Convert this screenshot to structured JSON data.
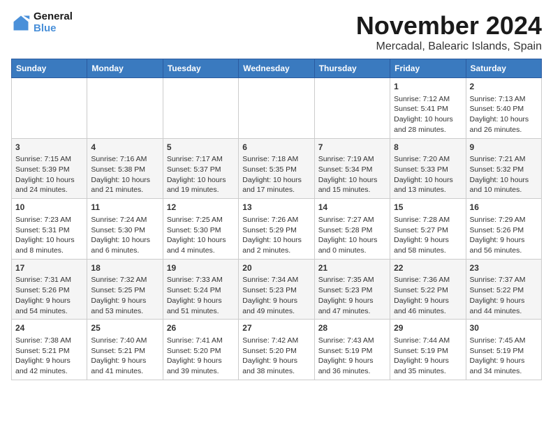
{
  "header": {
    "logo_line1": "General",
    "logo_line2": "Blue",
    "month_year": "November 2024",
    "location": "Mercadal, Balearic Islands, Spain"
  },
  "days_of_week": [
    "Sunday",
    "Monday",
    "Tuesday",
    "Wednesday",
    "Thursday",
    "Friday",
    "Saturday"
  ],
  "weeks": [
    [
      {
        "day": "",
        "sunrise": "",
        "sunset": "",
        "daylight": ""
      },
      {
        "day": "",
        "sunrise": "",
        "sunset": "",
        "daylight": ""
      },
      {
        "day": "",
        "sunrise": "",
        "sunset": "",
        "daylight": ""
      },
      {
        "day": "",
        "sunrise": "",
        "sunset": "",
        "daylight": ""
      },
      {
        "day": "",
        "sunrise": "",
        "sunset": "",
        "daylight": ""
      },
      {
        "day": "1",
        "sunrise": "Sunrise: 7:12 AM",
        "sunset": "Sunset: 5:41 PM",
        "daylight": "Daylight: 10 hours and 28 minutes."
      },
      {
        "day": "2",
        "sunrise": "Sunrise: 7:13 AM",
        "sunset": "Sunset: 5:40 PM",
        "daylight": "Daylight: 10 hours and 26 minutes."
      }
    ],
    [
      {
        "day": "3",
        "sunrise": "Sunrise: 7:15 AM",
        "sunset": "Sunset: 5:39 PM",
        "daylight": "Daylight: 10 hours and 24 minutes."
      },
      {
        "day": "4",
        "sunrise": "Sunrise: 7:16 AM",
        "sunset": "Sunset: 5:38 PM",
        "daylight": "Daylight: 10 hours and 21 minutes."
      },
      {
        "day": "5",
        "sunrise": "Sunrise: 7:17 AM",
        "sunset": "Sunset: 5:37 PM",
        "daylight": "Daylight: 10 hours and 19 minutes."
      },
      {
        "day": "6",
        "sunrise": "Sunrise: 7:18 AM",
        "sunset": "Sunset: 5:35 PM",
        "daylight": "Daylight: 10 hours and 17 minutes."
      },
      {
        "day": "7",
        "sunrise": "Sunrise: 7:19 AM",
        "sunset": "Sunset: 5:34 PM",
        "daylight": "Daylight: 10 hours and 15 minutes."
      },
      {
        "day": "8",
        "sunrise": "Sunrise: 7:20 AM",
        "sunset": "Sunset: 5:33 PM",
        "daylight": "Daylight: 10 hours and 13 minutes."
      },
      {
        "day": "9",
        "sunrise": "Sunrise: 7:21 AM",
        "sunset": "Sunset: 5:32 PM",
        "daylight": "Daylight: 10 hours and 10 minutes."
      }
    ],
    [
      {
        "day": "10",
        "sunrise": "Sunrise: 7:23 AM",
        "sunset": "Sunset: 5:31 PM",
        "daylight": "Daylight: 10 hours and 8 minutes."
      },
      {
        "day": "11",
        "sunrise": "Sunrise: 7:24 AM",
        "sunset": "Sunset: 5:30 PM",
        "daylight": "Daylight: 10 hours and 6 minutes."
      },
      {
        "day": "12",
        "sunrise": "Sunrise: 7:25 AM",
        "sunset": "Sunset: 5:30 PM",
        "daylight": "Daylight: 10 hours and 4 minutes."
      },
      {
        "day": "13",
        "sunrise": "Sunrise: 7:26 AM",
        "sunset": "Sunset: 5:29 PM",
        "daylight": "Daylight: 10 hours and 2 minutes."
      },
      {
        "day": "14",
        "sunrise": "Sunrise: 7:27 AM",
        "sunset": "Sunset: 5:28 PM",
        "daylight": "Daylight: 10 hours and 0 minutes."
      },
      {
        "day": "15",
        "sunrise": "Sunrise: 7:28 AM",
        "sunset": "Sunset: 5:27 PM",
        "daylight": "Daylight: 9 hours and 58 minutes."
      },
      {
        "day": "16",
        "sunrise": "Sunrise: 7:29 AM",
        "sunset": "Sunset: 5:26 PM",
        "daylight": "Daylight: 9 hours and 56 minutes."
      }
    ],
    [
      {
        "day": "17",
        "sunrise": "Sunrise: 7:31 AM",
        "sunset": "Sunset: 5:26 PM",
        "daylight": "Daylight: 9 hours and 54 minutes."
      },
      {
        "day": "18",
        "sunrise": "Sunrise: 7:32 AM",
        "sunset": "Sunset: 5:25 PM",
        "daylight": "Daylight: 9 hours and 53 minutes."
      },
      {
        "day": "19",
        "sunrise": "Sunrise: 7:33 AM",
        "sunset": "Sunset: 5:24 PM",
        "daylight": "Daylight: 9 hours and 51 minutes."
      },
      {
        "day": "20",
        "sunrise": "Sunrise: 7:34 AM",
        "sunset": "Sunset: 5:23 PM",
        "daylight": "Daylight: 9 hours and 49 minutes."
      },
      {
        "day": "21",
        "sunrise": "Sunrise: 7:35 AM",
        "sunset": "Sunset: 5:23 PM",
        "daylight": "Daylight: 9 hours and 47 minutes."
      },
      {
        "day": "22",
        "sunrise": "Sunrise: 7:36 AM",
        "sunset": "Sunset: 5:22 PM",
        "daylight": "Daylight: 9 hours and 46 minutes."
      },
      {
        "day": "23",
        "sunrise": "Sunrise: 7:37 AM",
        "sunset": "Sunset: 5:22 PM",
        "daylight": "Daylight: 9 hours and 44 minutes."
      }
    ],
    [
      {
        "day": "24",
        "sunrise": "Sunrise: 7:38 AM",
        "sunset": "Sunset: 5:21 PM",
        "daylight": "Daylight: 9 hours and 42 minutes."
      },
      {
        "day": "25",
        "sunrise": "Sunrise: 7:40 AM",
        "sunset": "Sunset: 5:21 PM",
        "daylight": "Daylight: 9 hours and 41 minutes."
      },
      {
        "day": "26",
        "sunrise": "Sunrise: 7:41 AM",
        "sunset": "Sunset: 5:20 PM",
        "daylight": "Daylight: 9 hours and 39 minutes."
      },
      {
        "day": "27",
        "sunrise": "Sunrise: 7:42 AM",
        "sunset": "Sunset: 5:20 PM",
        "daylight": "Daylight: 9 hours and 38 minutes."
      },
      {
        "day": "28",
        "sunrise": "Sunrise: 7:43 AM",
        "sunset": "Sunset: 5:19 PM",
        "daylight": "Daylight: 9 hours and 36 minutes."
      },
      {
        "day": "29",
        "sunrise": "Sunrise: 7:44 AM",
        "sunset": "Sunset: 5:19 PM",
        "daylight": "Daylight: 9 hours and 35 minutes."
      },
      {
        "day": "30",
        "sunrise": "Sunrise: 7:45 AM",
        "sunset": "Sunset: 5:19 PM",
        "daylight": "Daylight: 9 hours and 34 minutes."
      }
    ]
  ]
}
